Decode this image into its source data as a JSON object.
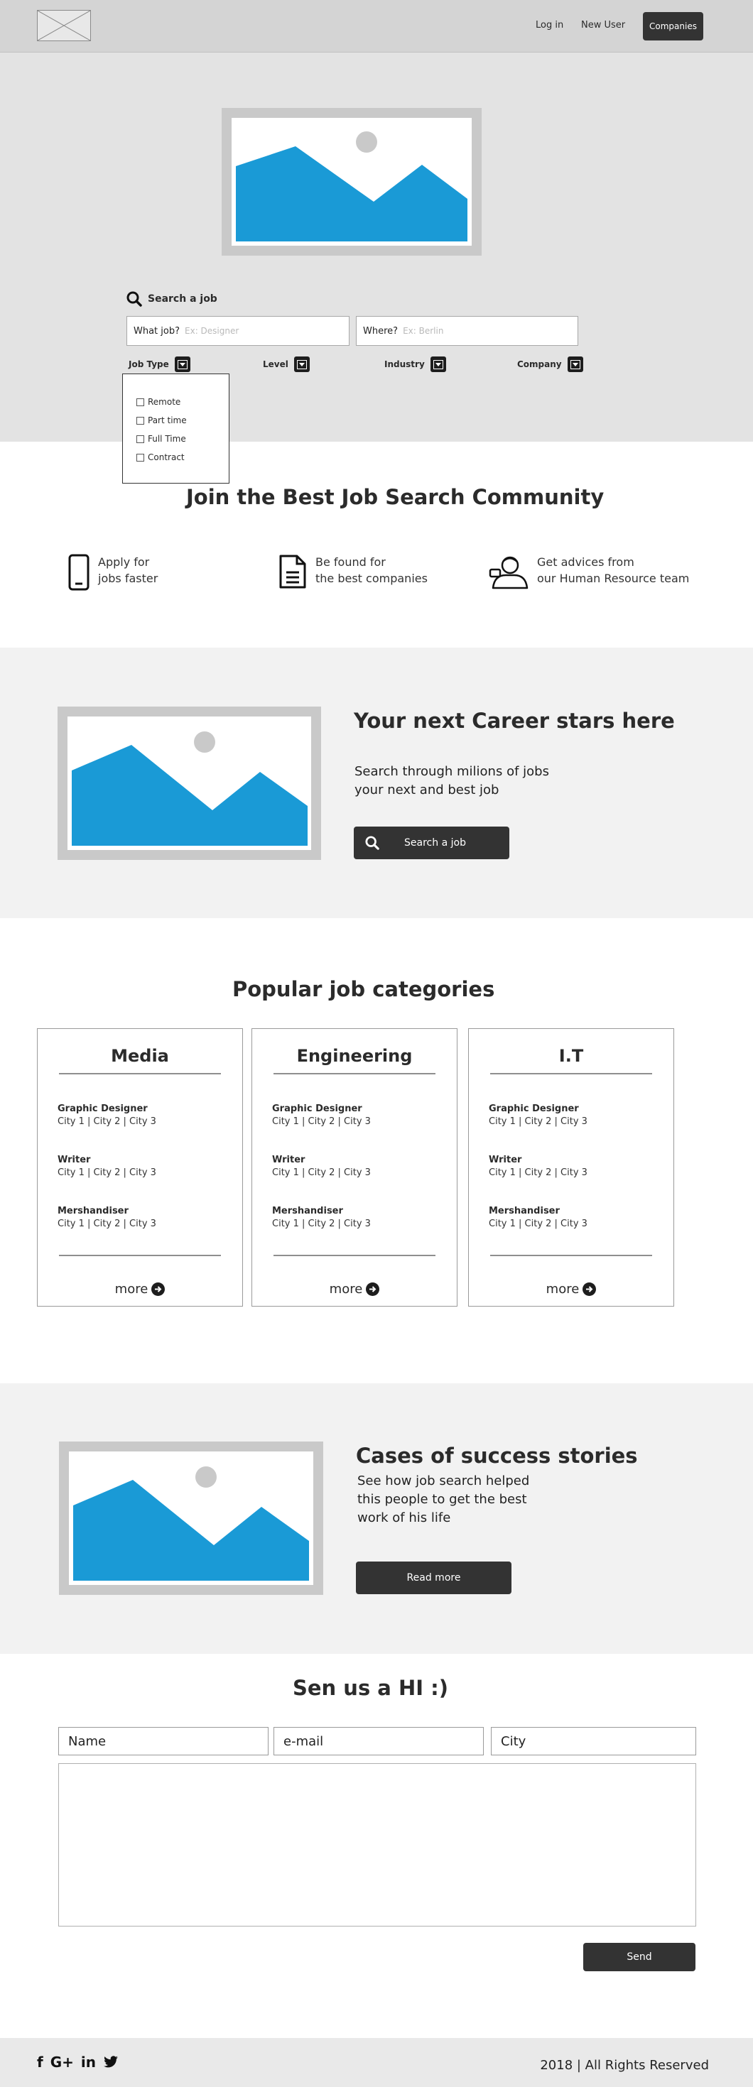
{
  "header": {
    "logo_icon": "placeholder-image-icon",
    "login_label": "Log in",
    "new_user_label": "New User",
    "companies_label": "Companies"
  },
  "hero": {
    "image_icon": "landscape-image-placeholder",
    "search_title": "Search a job",
    "search_icon": "search-icon",
    "what_label": "What job?",
    "what_placeholder": "Ex: Designer",
    "where_label": "Where?",
    "where_placeholder": "Ex: Berlin",
    "filters": [
      {
        "label": "Job Type"
      },
      {
        "label": "Level"
      },
      {
        "label": "Industry"
      },
      {
        "label": "Company"
      }
    ],
    "job_type_options": [
      "Remote",
      "Part time",
      "Full Time",
      "Contract"
    ]
  },
  "community": {
    "title": "Join the Best Job Search Community",
    "features": [
      {
        "icon": "smartphone-icon",
        "line1": "Apply for",
        "line2": "jobs faster"
      },
      {
        "icon": "document-icon",
        "line1": "Be found for",
        "line2": "the best companies"
      },
      {
        "icon": "advisor-person-icon",
        "line1": "Get advices from",
        "line2": "our Human Resource team"
      }
    ]
  },
  "career": {
    "title": "Your next Career stars here",
    "line1": "Search through milions of jobs",
    "line2": "your next and best job",
    "button_label": "Search a job"
  },
  "categories": {
    "title": "Popular job categories",
    "cards": [
      {
        "title": "Media",
        "jobs": [
          {
            "title": "Graphic Designer",
            "cities": "City 1 | City 2 | City 3"
          },
          {
            "title": "Writer",
            "cities": "City 1 | City 2 | City 3"
          },
          {
            "title": "Mershandiser",
            "cities": "City 1 | City 2 | City 3"
          }
        ],
        "more_label": "more"
      },
      {
        "title": "Engineering",
        "jobs": [
          {
            "title": "Graphic Designer",
            "cities": "City 1 | City 2 | City 3"
          },
          {
            "title": "Writer",
            "cities": "City 1 | City 2 | City 3"
          },
          {
            "title": "Mershandiser",
            "cities": "City 1 | City 2 | City 3"
          }
        ],
        "more_label": "more"
      },
      {
        "title": "I.T",
        "jobs": [
          {
            "title": "Graphic Designer",
            "cities": "City 1 | City 2 | City 3"
          },
          {
            "title": "Writer",
            "cities": "City 1 | City 2 | City 3"
          },
          {
            "title": "Mershandiser",
            "cities": "City 1 | City 2 | City 3"
          }
        ],
        "more_label": "more"
      }
    ]
  },
  "success": {
    "title": "Cases of success stories",
    "line1": "See how job search helped",
    "line2": "this people to get the best",
    "line3": "work of his life",
    "button_label": "Read more"
  },
  "contact": {
    "title": "Sen us a HI :)",
    "name_placeholder": "Name",
    "email_placeholder": "e-mail",
    "city_placeholder": "City",
    "send_label": "Send"
  },
  "footer": {
    "social": [
      "f",
      "G+",
      "in",
      "twitter"
    ],
    "copyright": "2018 | All Rights Reserved"
  },
  "colors": {
    "accent_blue": "#1a9ad6",
    "dark_button": "#333333",
    "header_gray": "#d4d4d4",
    "hero_gray": "#e3e3e3",
    "band_gray": "#f2f2f2"
  }
}
